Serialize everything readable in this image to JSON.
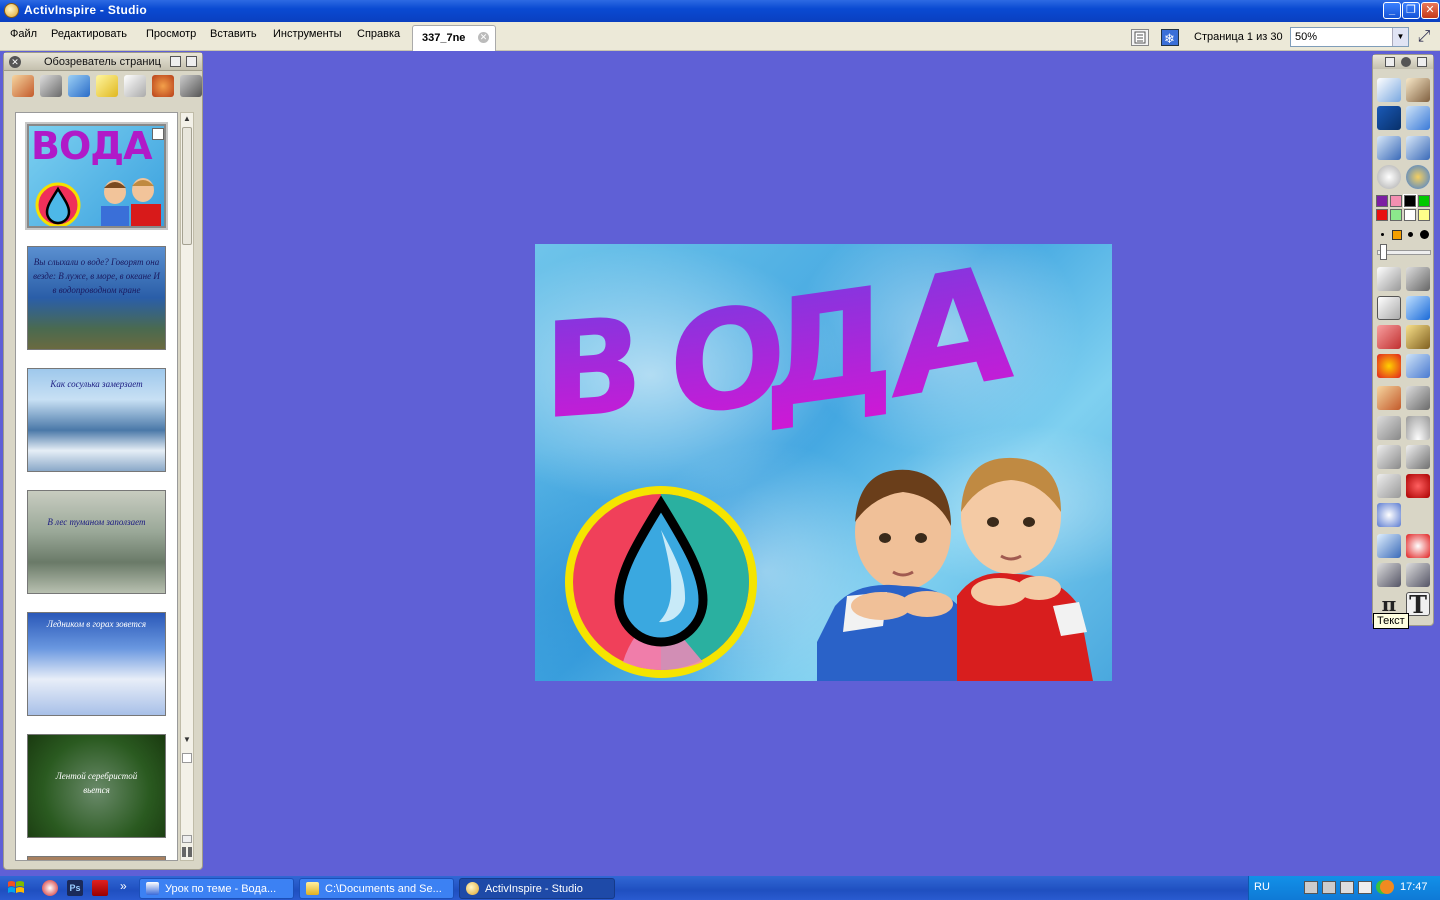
{
  "window": {
    "title": "ActivInspire - Studio",
    "minimize": "_",
    "restore": "❐",
    "close": "✕"
  },
  "menu": {
    "items": [
      "Файл",
      "Редактировать",
      "Просмотр",
      "Вставить",
      "Инструменты",
      "Справка"
    ]
  },
  "document_tab": {
    "label": "337_7ne"
  },
  "navigation": {
    "page_status": "Страница 1 из 30",
    "zoom_value": "50%"
  },
  "page_browser": {
    "title": "Обозреватель страниц",
    "thumbnails": [
      {
        "caption": "ВОДА",
        "selected": true
      },
      {
        "caption": "Вы слыхали о воде? Говорят она везде: В луже, в море, в океане И в водопроводном кране"
      },
      {
        "caption": "Как сосулька замерзает"
      },
      {
        "caption": "В лес туманом заползает"
      },
      {
        "caption": "Ледником в горах зовется"
      },
      {
        "caption": "Лентой серебристой вьется"
      }
    ]
  },
  "slide": {
    "title_letters": [
      "В",
      "О",
      "Д",
      "А"
    ]
  },
  "right_toolbar": {
    "colors": [
      "#7B1FA2",
      "#F48FB1",
      "#000000",
      "#00C800",
      "#E81010",
      "#8CE88C",
      "#FFFFFF",
      "#FFFF8A"
    ],
    "tooltip": "Текст"
  },
  "taskbar": {
    "tasks": [
      {
        "label": "Урок по теме - Вода..."
      },
      {
        "label": "C:\\Documents and Se..."
      },
      {
        "label": "ActivInspire - Studio",
        "active": true
      }
    ],
    "overflow": "»",
    "language": "RU",
    "clock": "17:47"
  }
}
